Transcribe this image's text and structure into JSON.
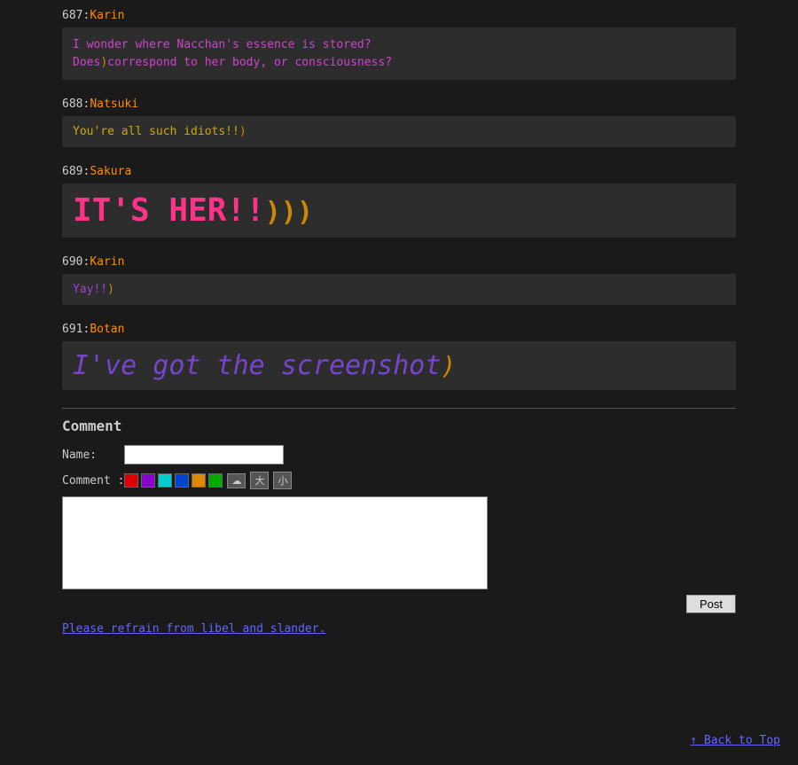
{
  "entries": [
    {
      "id": "entry-687",
      "number": "687",
      "name": "Karin",
      "name_class": "name-karin",
      "lines": [
        {
          "text": "I wonder where Nacchan's essence is stored?",
          "class": "text-purple-small"
        },
        {
          "text": "Does",
          "class": "text-purple-small",
          "emoji": "🌙",
          "rest": "correspond to her body, or consciousness?",
          "rest_class": "text-purple-small"
        }
      ],
      "multi_line": true
    },
    {
      "id": "entry-688",
      "number": "688",
      "name": "Natsuki",
      "name_class": "name-natsuki",
      "text": "You're all such idiots!!",
      "text_class": "text-yellow-small",
      "emoji": "🌙"
    },
    {
      "id": "entry-689",
      "number": "689",
      "name": "Sakura",
      "name_class": "name-sakura",
      "text": "IT'S HER!!",
      "text_class": "text-pink-large",
      "emojis": [
        "🌙",
        "🌙",
        "🌙"
      ]
    },
    {
      "id": "entry-690",
      "number": "690",
      "name": "Karin",
      "name_class": "name-karin",
      "text": "Yay!!",
      "text_class": "text-purple-small-690",
      "emoji": "🌙"
    },
    {
      "id": "entry-691",
      "number": "691",
      "name": "Botan",
      "name_class": "name-botan",
      "text": "I've got the screenshot",
      "text_class": "text-purple-large",
      "emoji": "🌙"
    }
  ],
  "form": {
    "title": "Comment",
    "name_label": "Name:",
    "comment_label": "Comment :",
    "color_buttons": [
      {
        "color": "#dd0000",
        "name": "red"
      },
      {
        "color": "#8800cc",
        "name": "purple"
      },
      {
        "color": "#00cccc",
        "name": "cyan"
      },
      {
        "color": "#0044cc",
        "name": "blue"
      },
      {
        "color": "#dd8800",
        "name": "orange"
      },
      {
        "color": "#00aa00",
        "name": "green"
      }
    ],
    "icon_buttons": [
      "☁",
      "大",
      "小"
    ],
    "post_button_label": "Post",
    "warning_text": "Please refrain from libel and slander."
  },
  "footer": {
    "back_to_top_label": "Back to Top"
  }
}
